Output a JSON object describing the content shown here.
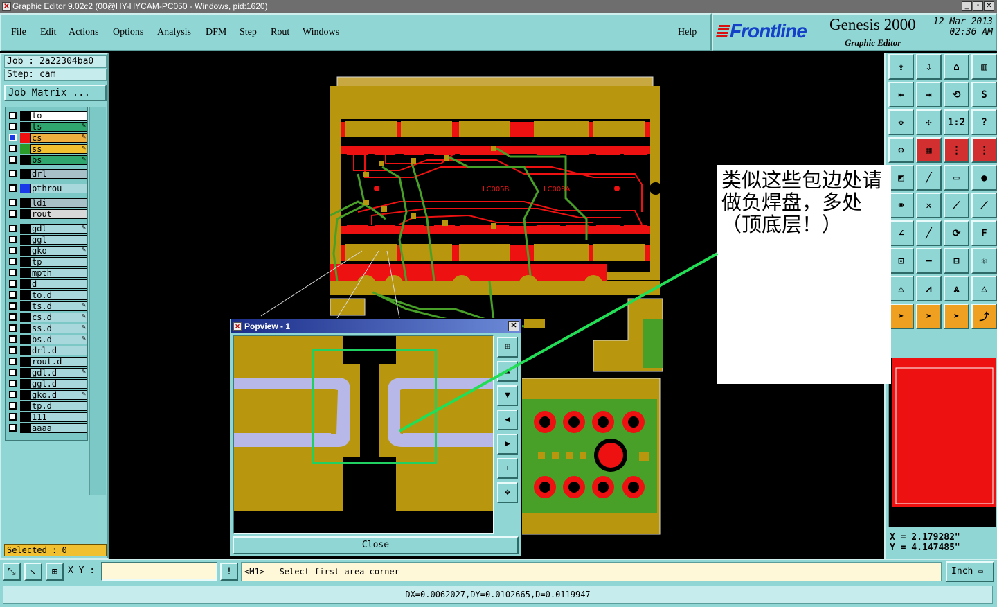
{
  "window": {
    "title": "Graphic Editor 9.02c2 (00@HY-HYCAM-PC050 - Windows, pid:1620)"
  },
  "menu": {
    "items": [
      "File",
      "Edit",
      "Actions",
      "Options",
      "Analysis",
      "DFM",
      "Step",
      "Rout",
      "Windows"
    ],
    "help": "Help"
  },
  "brand": {
    "logo": "Frontline",
    "product": "Genesis 2000",
    "subtitle": "Graphic Editor",
    "date": "12 Mar 2013",
    "time": "02:36 AM"
  },
  "job": {
    "job_label": "Job : 2a22304ba0",
    "step_label": "Step: cam",
    "matrix_button": "Job Matrix ..."
  },
  "layers": [
    {
      "name": "to",
      "color": "#ffffff",
      "swatch": "#000000",
      "editable": false,
      "active": false
    },
    {
      "name": "ts",
      "color": "#2ea66e",
      "swatch": "#000000",
      "editable": true,
      "active": false
    },
    {
      "name": "cs",
      "color": "#f0b040",
      "swatch": "#ee1111",
      "editable": true,
      "active": true
    },
    {
      "name": "ss",
      "color": "#f0c030",
      "swatch": "#2a9a2a",
      "editable": true,
      "active": false
    },
    {
      "name": "bs",
      "color": "#2ea66e",
      "swatch": "#000000",
      "editable": true,
      "active": false
    },
    {
      "name": "drl",
      "color": "#a8c0c8",
      "swatch": "#000000",
      "editable": false,
      "active": false
    },
    {
      "name": "pthrou",
      "color": "#a8d8dc",
      "swatch": "#1a3ae8",
      "editable": false,
      "active": false
    },
    {
      "name": "ldi",
      "color": "#a8c0c8",
      "swatch": "#000000",
      "editable": false,
      "active": false
    },
    {
      "name": "rout",
      "color": "#d8d8d8",
      "swatch": "#000000",
      "editable": false,
      "active": false
    },
    {
      "name": "gdl",
      "color": "#a8d8dc",
      "swatch": "#000000",
      "editable": true,
      "active": false
    },
    {
      "name": "ggl",
      "color": "#a8d8dc",
      "swatch": "#000000",
      "editable": false,
      "active": false
    },
    {
      "name": "gko",
      "color": "#a8d8dc",
      "swatch": "#000000",
      "editable": true,
      "active": false
    },
    {
      "name": "tp",
      "color": "#a8d8dc",
      "swatch": "#000000",
      "editable": false,
      "active": false
    },
    {
      "name": "mpth",
      "color": "#a8d8dc",
      "swatch": "#000000",
      "editable": false,
      "active": false
    },
    {
      "name": "d",
      "color": "#a8d8dc",
      "swatch": "#000000",
      "editable": false,
      "active": false
    },
    {
      "name": "to.d",
      "color": "#a8d8dc",
      "swatch": "#000000",
      "editable": false,
      "active": false
    },
    {
      "name": "ts.d",
      "color": "#a8d8dc",
      "swatch": "#000000",
      "editable": true,
      "active": false
    },
    {
      "name": "cs.d",
      "color": "#a8d8dc",
      "swatch": "#000000",
      "editable": true,
      "active": false
    },
    {
      "name": "ss.d",
      "color": "#a8d8dc",
      "swatch": "#000000",
      "editable": true,
      "active": false
    },
    {
      "name": "bs.d",
      "color": "#a8d8dc",
      "swatch": "#000000",
      "editable": true,
      "active": false
    },
    {
      "name": "drl.d",
      "color": "#a8d8dc",
      "swatch": "#000000",
      "editable": false,
      "active": false
    },
    {
      "name": "rout.d",
      "color": "#a8d8dc",
      "swatch": "#000000",
      "editable": false,
      "active": false
    },
    {
      "name": "gdl.d",
      "color": "#a8d8dc",
      "swatch": "#000000",
      "editable": true,
      "active": false
    },
    {
      "name": "ggl.d",
      "color": "#a8d8dc",
      "swatch": "#000000",
      "editable": false,
      "active": false
    },
    {
      "name": "gko.d",
      "color": "#a8d8dc",
      "swatch": "#000000",
      "editable": true,
      "active": false
    },
    {
      "name": "tp.d",
      "color": "#a8d8dc",
      "swatch": "#000000",
      "editable": false,
      "active": false
    },
    {
      "name": "111",
      "color": "#a8d8dc",
      "swatch": "#000000",
      "editable": false,
      "active": false
    },
    {
      "name": "aaaa",
      "color": "#a8d8dc",
      "swatch": "#000000",
      "editable": false,
      "active": false
    }
  ],
  "selected": "Selected : 0",
  "board": {
    "labels": [
      "LC005B",
      "LC008A"
    ]
  },
  "popview": {
    "title": "Popview - 1",
    "close": "Close"
  },
  "annotation": "类似这些包边处请做负焊盘，多处（顶底层！）",
  "coords": {
    "x": "X = 2.179282\"",
    "y": "Y = 4.147485\""
  },
  "bottom": {
    "xy_label": "X Y :",
    "xy_value": "",
    "prompt": "<M1> - Select first area corner",
    "unit": "Inch"
  },
  "status": "DX=0.0062027,DY=0.0102665,D=0.0119947",
  "tool_icons": [
    "home-up",
    "step-down",
    "house",
    "panel",
    "left-in",
    "right-out",
    "swap",
    "s-curve",
    "fit",
    "center",
    "one-to-one",
    "help",
    "measure",
    "grid",
    "layer-red",
    "layer-red2",
    "pad",
    "line",
    "ruler",
    "dot",
    "nodes",
    "cross",
    "move",
    "move2",
    "slope",
    "line-diag",
    "arc",
    "ff",
    "snap",
    "dash",
    "frame",
    "gear",
    "tri1",
    "tri2",
    "tri3",
    "tri4",
    "arrow",
    "arrow-sel",
    "arrow-sel2",
    "route"
  ]
}
